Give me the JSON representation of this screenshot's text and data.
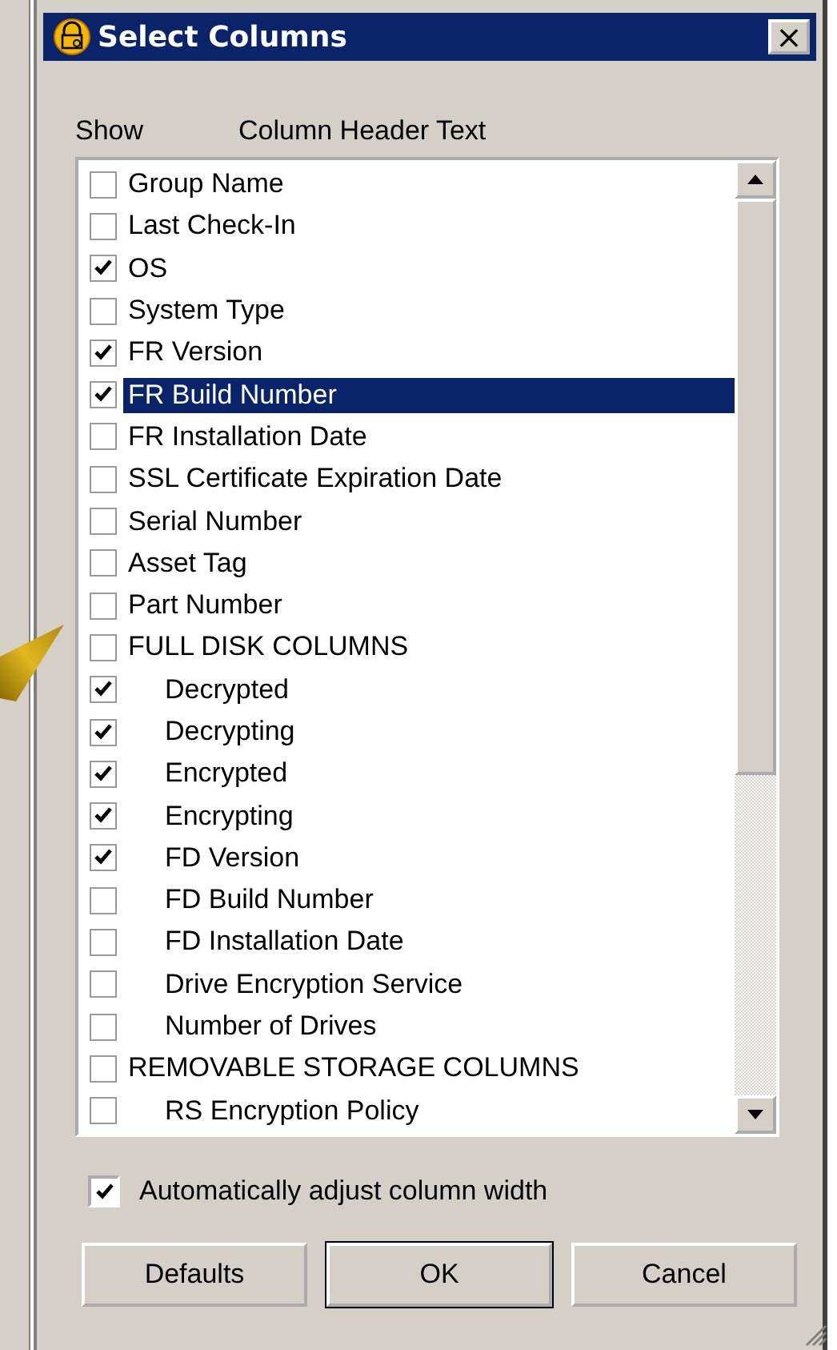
{
  "window": {
    "title": "Select Columns",
    "close": "×"
  },
  "headers": [
    "Show",
    "Column Header Text"
  ],
  "columns": [
    {
      "label": "Group Name",
      "checked": false,
      "selected": false
    },
    {
      "label": "Last Check-In",
      "checked": false,
      "selected": false
    },
    {
      "label": "OS",
      "checked": true,
      "selected": false
    },
    {
      "label": "System Type",
      "checked": false,
      "selected": false
    },
    {
      "label": "FR Version",
      "checked": true,
      "selected": false
    },
    {
      "label": "FR Build Number",
      "checked": true,
      "selected": true
    },
    {
      "label": "FR Installation Date",
      "checked": false,
      "selected": false
    },
    {
      "label": "SSL Certificate Expiration Date",
      "checked": false,
      "selected": false
    },
    {
      "label": "Serial Number",
      "checked": false,
      "selected": false
    },
    {
      "label": "Asset Tag",
      "checked": false,
      "selected": false
    },
    {
      "label": "Part Number",
      "checked": false,
      "selected": false
    },
    {
      "label": "FULL DISK COLUMNS",
      "checked": false,
      "selected": false,
      "children": [
        {
          "label": "Decrypted",
          "checked": true,
          "selected": false
        },
        {
          "label": "Decrypting",
          "checked": true,
          "selected": false
        },
        {
          "label": "Encrypted",
          "checked": true,
          "selected": false
        },
        {
          "label": "Encrypting",
          "checked": true,
          "selected": false
        },
        {
          "label": "FD Version",
          "checked": true,
          "selected": false
        },
        {
          "label": "FD Build Number",
          "checked": false,
          "selected": false
        },
        {
          "label": "FD Installation Date",
          "checked": false,
          "selected": false
        },
        {
          "label": "Drive Encryption Service",
          "checked": false,
          "selected": false
        },
        {
          "label": "Number of Drives",
          "checked": false,
          "selected": false
        }
      ]
    },
    {
      "label": "REMOVABLE STORAGE COLUMNS",
      "checked": false,
      "selected": false,
      "children": [
        {
          "label": "RS Encryption Policy",
          "checked": false,
          "selected": false
        }
      ]
    }
  ],
  "auto_adjust": {
    "label": "Automatically adjust column width",
    "checked": true
  },
  "buttons": [
    {
      "label": "Defaults",
      "default": false
    },
    {
      "label": "OK",
      "default": true
    },
    {
      "label": "Cancel",
      "default": false
    }
  ]
}
